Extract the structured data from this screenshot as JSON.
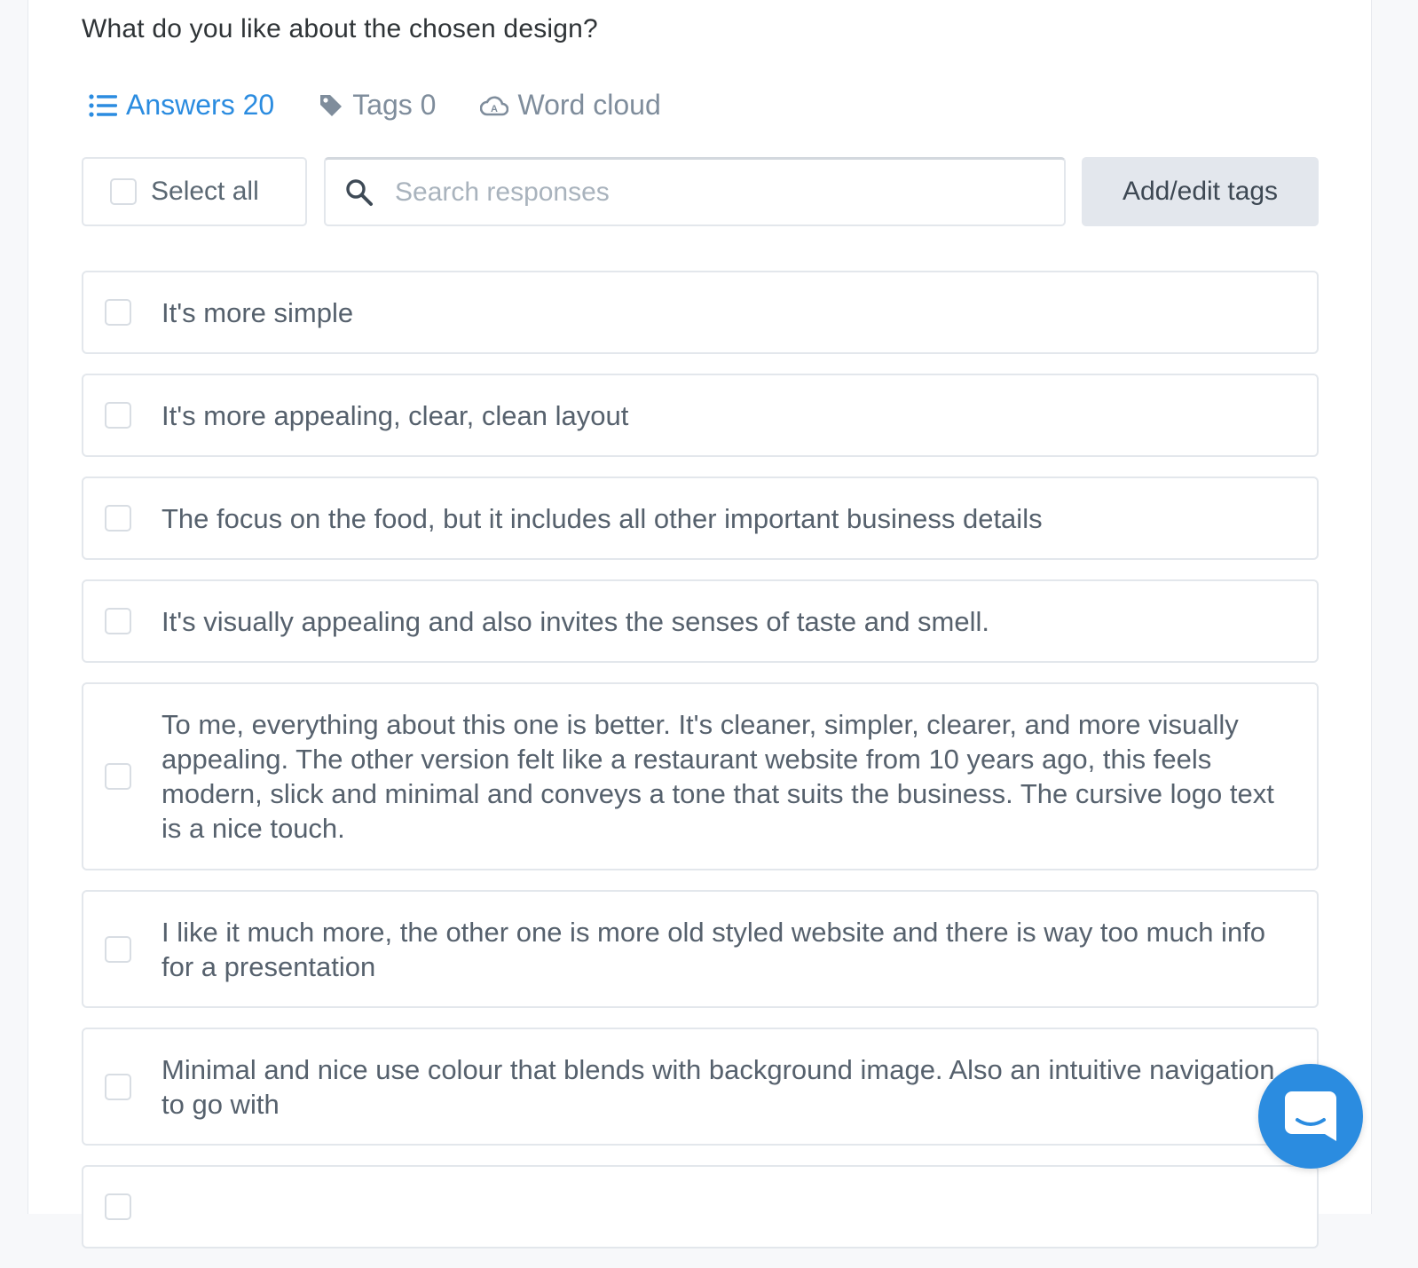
{
  "question": "What do you like about the chosen design?",
  "tabs": [
    {
      "icon": "list-icon",
      "label": "Answers 20",
      "active": true
    },
    {
      "icon": "tag-icon",
      "label": "Tags 0",
      "active": false
    },
    {
      "icon": "cloud-icon",
      "label": "Word cloud",
      "active": false
    }
  ],
  "toolbar": {
    "select_all_label": "Select all",
    "search_placeholder": "Search responses",
    "add_tags_label": "Add/edit tags"
  },
  "answers": [
    "It's more simple",
    "It's more appealing, clear, clean layout",
    "The focus on the food, but it includes all other important business details",
    "It's visually appealing and also invites the senses of taste and smell.",
    "To me, everything about this one is better. It's cleaner, simpler, clearer, and more visually appealing. The other version felt like a restaurant website from 10 years ago, this feels modern, slick and minimal and conveys a tone that suits the business. The cursive logo text is a nice touch.",
    "I like it much more, the other one is more old styled website and there is way too much info for a presentation",
    "Minimal and nice use colour that blends with background image. Also an intuitive navigation to go with",
    ""
  ],
  "colors": {
    "accent": "#2b8ce0",
    "muted_text": "#7f8d9c",
    "border": "#e3e7ec",
    "button_bg": "#e3e7ed"
  }
}
